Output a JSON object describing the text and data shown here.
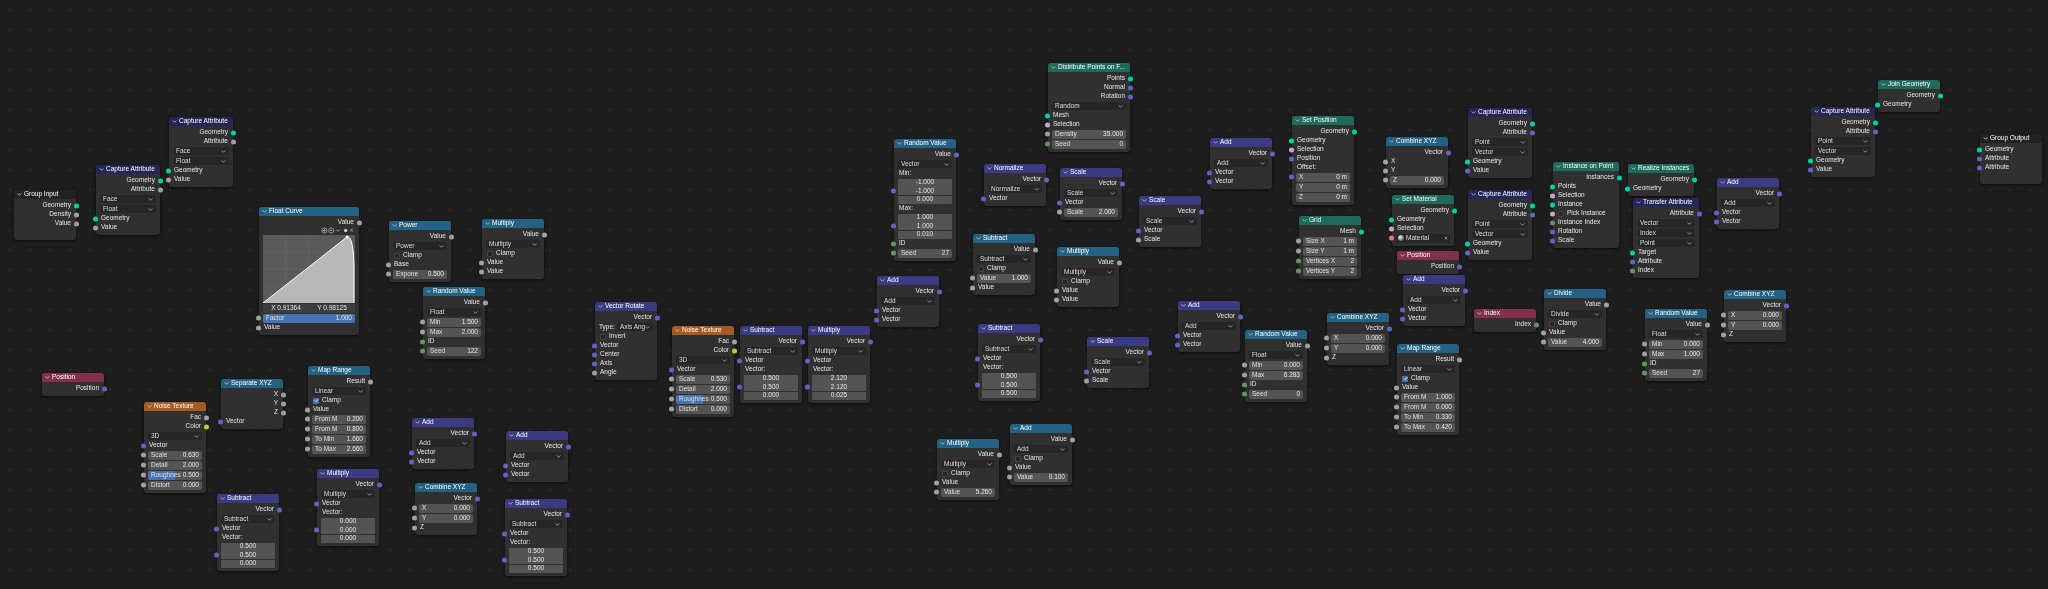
{
  "nodes": [
    {
      "title": "Group Input",
      "kind": "group",
      "rows": [
        {
          "kind": "out",
          "label": "Geometry",
          "color": "#00d6a3"
        },
        {
          "kind": "out",
          "label": "Density",
          "color": "#a1a1a1"
        },
        {
          "kind": "out",
          "label": "Value",
          "color": "#a1a1a1"
        },
        {
          "kind": "outstub"
        }
      ]
    },
    {
      "title": "Capture Attribute",
      "kind": "attribute",
      "rows": [
        {
          "kind": "out",
          "label": "Geometry",
          "color": "#00d6a3"
        },
        {
          "kind": "out",
          "label": "Attribute",
          "color": "#a1a1a1"
        },
        {
          "kind": "menu",
          "value": "Face"
        },
        {
          "kind": "menu",
          "value": "Float"
        },
        {
          "kind": "in",
          "label": "Geometry",
          "color": "#00d6a3"
        },
        {
          "kind": "in",
          "label": "Value",
          "color": "#a1a1a1"
        }
      ]
    },
    {
      "title": "Capture Attribute",
      "kind": "attribute",
      "rows": [
        {
          "kind": "out",
          "label": "Geometry",
          "color": "#00d6a3"
        },
        {
          "kind": "out",
          "label": "Attribute",
          "color": "#a1a1a1"
        },
        {
          "kind": "menu",
          "value": "Face"
        },
        {
          "kind": "menu",
          "value": "Float"
        },
        {
          "kind": "in",
          "label": "Geometry",
          "color": "#00d6a3"
        },
        {
          "kind": "in",
          "label": "Value",
          "color": "#a1a1a1"
        }
      ]
    },
    {
      "title": "Float Curve",
      "kind": "converter",
      "rows": [
        {
          "kind": "out",
          "label": "Value",
          "color": "#a1a1a1"
        },
        {
          "kind": "curve",
          "x_reading": "X 0.91364",
          "y_reading": "Y 0.98125"
        },
        {
          "kind": "slider",
          "label": "Factor",
          "value": "1.000",
          "level": 1,
          "color": "#a1a1a1"
        },
        {
          "kind": "in",
          "label": "Value",
          "color": "#a1a1a1"
        }
      ]
    },
    {
      "title": "Power",
      "kind": "converter",
      "rows": [
        {
          "kind": "out",
          "label": "Value",
          "color": "#a1a1a1"
        },
        {
          "kind": "menu",
          "value": "Power"
        },
        {
          "kind": "check",
          "label": "Clamp",
          "checked": false
        },
        {
          "kind": "in",
          "label": "Base",
          "color": "#a1a1a1"
        },
        {
          "kind": "field",
          "label": "Expone",
          "value": "0.500",
          "color": "#a1a1a1"
        }
      ]
    },
    {
      "title": "Random Value",
      "kind": "converter",
      "rows": [
        {
          "kind": "out",
          "label": "Value",
          "color": "#a1a1a1"
        },
        {
          "kind": "menu",
          "value": "Float"
        },
        {
          "kind": "field",
          "label": "Min",
          "value": "1.500",
          "color": "#a1a1a1"
        },
        {
          "kind": "field",
          "label": "Max",
          "value": "2.000",
          "color": "#a1a1a1"
        },
        {
          "kind": "in",
          "label": "ID",
          "color": "#5e9962"
        },
        {
          "kind": "field",
          "label": "Seed",
          "value": "122",
          "color": "#5e9962"
        }
      ]
    },
    {
      "title": "Multiply",
      "kind": "converter",
      "rows": [
        {
          "kind": "out",
          "label": "Value",
          "color": "#a1a1a1"
        },
        {
          "kind": "menu",
          "value": "Multiply"
        },
        {
          "kind": "check",
          "label": "Clamp",
          "checked": false
        },
        {
          "kind": "in",
          "label": "Value",
          "color": "#a1a1a1"
        },
        {
          "kind": "in",
          "label": "Value",
          "color": "#a1a1a1"
        }
      ]
    },
    {
      "title": "Position",
      "kind": "input",
      "rows": [
        {
          "kind": "out",
          "label": "Position",
          "color": "#6363c7"
        }
      ]
    },
    {
      "title": "Noise Texture",
      "kind": "texture",
      "rows": [
        {
          "kind": "out",
          "label": "Fac",
          "color": "#a1a1a1"
        },
        {
          "kind": "out",
          "label": "Color",
          "color": "#c7c729"
        },
        {
          "kind": "menu",
          "value": "3D"
        },
        {
          "kind": "in",
          "label": "Vector",
          "color": "#6363c7"
        },
        {
          "kind": "field",
          "label": "Scale",
          "value": "0.630",
          "color": "#a1a1a1"
        },
        {
          "kind": "field",
          "label": "Detail",
          "value": "2.000",
          "color": "#a1a1a1"
        },
        {
          "kind": "slider",
          "label": "Roughnes",
          "value": "0.500",
          "level": 0.5,
          "color": "#a1a1a1"
        },
        {
          "kind": "field",
          "label": "Distort",
          "value": "0.000",
          "color": "#a1a1a1"
        }
      ]
    },
    {
      "title": "Separate XYZ",
      "kind": "converter",
      "rows": [
        {
          "kind": "out",
          "label": "X",
          "color": "#a1a1a1"
        },
        {
          "kind": "out",
          "label": "Y",
          "color": "#a1a1a1"
        },
        {
          "kind": "out",
          "label": "Z",
          "color": "#a1a1a1"
        },
        {
          "kind": "in",
          "label": "Vector",
          "color": "#6363c7"
        }
      ]
    },
    {
      "title": "Map Range",
      "kind": "converter",
      "rows": [
        {
          "kind": "out",
          "label": "Result",
          "color": "#a1a1a1"
        },
        {
          "kind": "menu",
          "value": "Linear"
        },
        {
          "kind": "check",
          "label": "Clamp",
          "checked": true
        },
        {
          "kind": "in",
          "label": "Value",
          "color": "#a1a1a1"
        },
        {
          "kind": "field",
          "label": "From M",
          "value": "0.200",
          "color": "#a1a1a1"
        },
        {
          "kind": "field",
          "label": "From M",
          "value": "0.800",
          "color": "#a1a1a1"
        },
        {
          "kind": "field",
          "label": "To Min",
          "value": "1.660",
          "color": "#a1a1a1"
        },
        {
          "kind": "field",
          "label": "To Max",
          "value": "2.660",
          "color": "#a1a1a1"
        }
      ]
    },
    {
      "title": "Subtract",
      "kind": "vector",
      "rows": [
        {
          "kind": "out",
          "label": "Vector",
          "color": "#6363c7"
        },
        {
          "kind": "menu",
          "value": "Subtract"
        },
        {
          "kind": "in",
          "label": "Vector",
          "color": "#6363c7"
        },
        {
          "kind": "label",
          "text": "Vector:"
        },
        {
          "kind": "vector",
          "values": [
            "0.500",
            "0.500",
            "0.000"
          ],
          "color": "#6363c7"
        }
      ]
    },
    {
      "title": "Multiply",
      "kind": "vector",
      "rows": [
        {
          "kind": "out",
          "label": "Vector",
          "color": "#6363c7"
        },
        {
          "kind": "menu",
          "value": "Multiply"
        },
        {
          "kind": "in",
          "label": "Vector",
          "color": "#6363c7"
        },
        {
          "kind": "label",
          "text": "Vector:"
        },
        {
          "kind": "vector",
          "values": [
            "0.000",
            "0.000",
            "0.000"
          ],
          "color": "#6363c7"
        }
      ]
    },
    {
      "title": "Add",
      "kind": "vector",
      "rows": [
        {
          "kind": "out",
          "label": "Vector",
          "color": "#6363c7"
        },
        {
          "kind": "menu",
          "value": "Add"
        },
        {
          "kind": "in",
          "label": "Vector",
          "color": "#6363c7"
        },
        {
          "kind": "in",
          "label": "Vector",
          "color": "#6363c7"
        }
      ]
    },
    {
      "title": "Combine XYZ",
      "kind": "converter",
      "rows": [
        {
          "kind": "out",
          "label": "Vector",
          "color": "#6363c7"
        },
        {
          "kind": "field",
          "label": "X",
          "value": "0.000",
          "color": "#a1a1a1"
        },
        {
          "kind": "field",
          "label": "Y",
          "value": "0.000",
          "color": "#a1a1a1"
        },
        {
          "kind": "in",
          "label": "Z",
          "color": "#a1a1a1"
        }
      ]
    },
    {
      "title": "Add",
      "kind": "vector",
      "rows": [
        {
          "kind": "out",
          "label": "Vector",
          "color": "#6363c7"
        },
        {
          "kind": "menu",
          "value": "Add"
        },
        {
          "kind": "in",
          "label": "Vector",
          "color": "#6363c7"
        },
        {
          "kind": "in",
          "label": "Vector",
          "color": "#6363c7"
        }
      ]
    },
    {
      "title": "Subtract",
      "kind": "vector",
      "rows": [
        {
          "kind": "out",
          "label": "Vector",
          "color": "#6363c7"
        },
        {
          "kind": "menu",
          "value": "Subtract"
        },
        {
          "kind": "in",
          "label": "Vector",
          "color": "#6363c7"
        },
        {
          "kind": "label",
          "text": "Vector:"
        },
        {
          "kind": "vector",
          "values": [
            "0.500",
            "0.500",
            "0.500"
          ],
          "color": "#6363c7"
        }
      ]
    },
    {
      "title": "Vector Rotate",
      "kind": "vector",
      "rows": [
        {
          "kind": "out",
          "label": "Vector",
          "color": "#6363c7"
        },
        {
          "kind": "menu",
          "label": "Type:",
          "value": "Axis Ang"
        },
        {
          "kind": "check",
          "label": "Invert",
          "checked": false
        },
        {
          "kind": "in",
          "label": "Vector",
          "color": "#6363c7"
        },
        {
          "kind": "in",
          "label": "Center",
          "color": "#6363c7"
        },
        {
          "kind": "in",
          "label": "Axis",
          "color": "#6363c7"
        },
        {
          "kind": "in",
          "label": "Angle",
          "color": "#a1a1a1"
        }
      ]
    },
    {
      "title": "Noise Texture",
      "kind": "texture",
      "rows": [
        {
          "kind": "out",
          "label": "Fac",
          "color": "#a1a1a1"
        },
        {
          "kind": "out",
          "label": "Color",
          "color": "#c7c729"
        },
        {
          "kind": "menu",
          "value": "3D"
        },
        {
          "kind": "in",
          "label": "Vector",
          "color": "#6363c7"
        },
        {
          "kind": "field",
          "label": "Scale",
          "value": "0.530",
          "color": "#a1a1a1"
        },
        {
          "kind": "field",
          "label": "Detail",
          "value": "2.000",
          "color": "#a1a1a1"
        },
        {
          "kind": "slider",
          "label": "Roughnes",
          "value": "0.500",
          "level": 0.5,
          "color": "#a1a1a1"
        },
        {
          "kind": "field",
          "label": "Distort",
          "value": "0.000",
          "color": "#a1a1a1"
        }
      ]
    },
    {
      "title": "Subtract",
      "kind": "vector",
      "rows": [
        {
          "kind": "out",
          "label": "Vector",
          "color": "#6363c7"
        },
        {
          "kind": "menu",
          "value": "Subtract"
        },
        {
          "kind": "in",
          "label": "Vector",
          "color": "#6363c7"
        },
        {
          "kind": "label",
          "text": "Vector:"
        },
        {
          "kind": "vector",
          "values": [
            "0.500",
            "0.500",
            "0.000"
          ],
          "color": "#6363c7"
        }
      ]
    },
    {
      "title": "Multiply",
      "kind": "vector",
      "rows": [
        {
          "kind": "out",
          "label": "Vector",
          "color": "#6363c7"
        },
        {
          "kind": "menu",
          "value": "Multiply"
        },
        {
          "kind": "in",
          "label": "Vector",
          "color": "#6363c7"
        },
        {
          "kind": "label",
          "text": "Vector:"
        },
        {
          "kind": "vector",
          "values": [
            "2.120",
            "2.120",
            "0.025"
          ],
          "color": "#6363c7"
        }
      ]
    },
    {
      "title": "Add",
      "kind": "vector",
      "rows": [
        {
          "kind": "out",
          "label": "Vector",
          "color": "#6363c7"
        },
        {
          "kind": "menu",
          "value": "Add"
        },
        {
          "kind": "in",
          "label": "Vector",
          "color": "#6363c7"
        },
        {
          "kind": "in",
          "label": "Vector",
          "color": "#6363c7"
        }
      ]
    },
    {
      "title": "Random Value",
      "kind": "converter",
      "rows": [
        {
          "kind": "out",
          "label": "Value",
          "color": "#6363c7"
        },
        {
          "kind": "menu",
          "value": "Vector"
        },
        {
          "kind": "label",
          "text": "Min:"
        },
        {
          "kind": "vector",
          "values": [
            "-1.000",
            "-1.000",
            "0.000"
          ],
          "color": "#6363c7"
        },
        {
          "kind": "label",
          "text": "Max:"
        },
        {
          "kind": "vector",
          "values": [
            "1.000",
            "1.000",
            "0.010"
          ],
          "color": "#6363c7"
        },
        {
          "kind": "in",
          "label": "ID",
          "color": "#5e9962"
        },
        {
          "kind": "field",
          "label": "Seed",
          "value": "27",
          "color": "#5e9962"
        }
      ]
    },
    {
      "title": "Normalize",
      "kind": "vector",
      "rows": [
        {
          "kind": "out",
          "label": "Vector",
          "color": "#6363c7"
        },
        {
          "kind": "menu",
          "value": "Normalize"
        },
        {
          "kind": "in",
          "label": "Vector",
          "color": "#6363c7"
        }
      ]
    },
    {
      "title": "Subtract",
      "kind": "converter",
      "rows": [
        {
          "kind": "out",
          "label": "Value",
          "color": "#a1a1a1"
        },
        {
          "kind": "menu",
          "value": "Subtract"
        },
        {
          "kind": "check",
          "label": "Clamp",
          "checked": false
        },
        {
          "kind": "field",
          "label": "Value",
          "value": "1.000",
          "color": "#a1a1a1"
        },
        {
          "kind": "in",
          "label": "Value",
          "color": "#a1a1a1"
        }
      ]
    },
    {
      "title": "Subtract",
      "kind": "vector",
      "rows": [
        {
          "kind": "out",
          "label": "Vector",
          "color": "#6363c7"
        },
        {
          "kind": "menu",
          "value": "Subtract"
        },
        {
          "kind": "in",
          "label": "Vector",
          "color": "#6363c7"
        },
        {
          "kind": "label",
          "text": "Vector:"
        },
        {
          "kind": "vector",
          "values": [
            "0.500",
            "0.500",
            "0.500"
          ],
          "color": "#6363c7"
        }
      ]
    },
    {
      "title": "Multiply",
      "kind": "converter",
      "rows": [
        {
          "kind": "out",
          "label": "Value",
          "color": "#a1a1a1"
        },
        {
          "kind": "menu",
          "value": "Multiply"
        },
        {
          "kind": "check",
          "label": "Clamp",
          "checked": false
        },
        {
          "kind": "in",
          "label": "Value",
          "color": "#a1a1a1"
        },
        {
          "kind": "field",
          "label": "Value",
          "value": "5.260",
          "color": "#a1a1a1"
        }
      ]
    },
    {
      "title": "Add",
      "kind": "converter",
      "rows": [
        {
          "kind": "out",
          "label": "Value",
          "color": "#a1a1a1"
        },
        {
          "kind": "menu",
          "value": "Add"
        },
        {
          "kind": "check",
          "label": "Clamp",
          "checked": false
        },
        {
          "kind": "in",
          "label": "Value",
          "color": "#a1a1a1"
        },
        {
          "kind": "field",
          "label": "Value",
          "value": "0.100",
          "color": "#a1a1a1"
        }
      ]
    },
    {
      "title": "Distribute Points on F...",
      "kind": "geometry",
      "rows": [
        {
          "kind": "out",
          "label": "Points",
          "color": "#00d6a3"
        },
        {
          "kind": "out",
          "label": "Normal",
          "color": "#6363c7"
        },
        {
          "kind": "out",
          "label": "Rotation",
          "color": "#6363c7"
        },
        {
          "kind": "menu",
          "value": "Random"
        },
        {
          "kind": "in",
          "label": "Mesh",
          "color": "#00d6a3"
        },
        {
          "kind": "in",
          "label": "Selection",
          "color": "#cca6d6"
        },
        {
          "kind": "field",
          "label": "Density",
          "value": "35.000",
          "color": "#a1a1a1"
        },
        {
          "kind": "field",
          "label": "Seed",
          "value": "0",
          "color": "#5e9962"
        }
      ]
    },
    {
      "title": "Scale",
      "kind": "vector",
      "rows": [
        {
          "kind": "out",
          "label": "Vector",
          "color": "#6363c7"
        },
        {
          "kind": "menu",
          "value": "Scale"
        },
        {
          "kind": "in",
          "label": "Vector",
          "color": "#6363c7"
        },
        {
          "kind": "field",
          "label": "Scale",
          "value": "2.000",
          "color": "#a1a1a1"
        }
      ]
    },
    {
      "title": "Scale",
      "kind": "vector",
      "rows": [
        {
          "kind": "out",
          "label": "Vector",
          "color": "#6363c7"
        },
        {
          "kind": "menu",
          "value": "Scale"
        },
        {
          "kind": "in",
          "label": "Vector",
          "color": "#6363c7"
        },
        {
          "kind": "in",
          "label": "Scale",
          "color": "#a1a1a1"
        }
      ]
    },
    {
      "title": "Add",
      "kind": "vector",
      "rows": [
        {
          "kind": "out",
          "label": "Vector",
          "color": "#6363c7"
        },
        {
          "kind": "menu",
          "value": "Add"
        },
        {
          "kind": "in",
          "label": "Vector",
          "color": "#6363c7"
        },
        {
          "kind": "in",
          "label": "Vector",
          "color": "#6363c7"
        }
      ]
    },
    {
      "title": "Multiply",
      "kind": "converter",
      "rows": [
        {
          "kind": "out",
          "label": "Value",
          "color": "#a1a1a1"
        },
        {
          "kind": "menu",
          "value": "Multiply"
        },
        {
          "kind": "check",
          "label": "Clamp",
          "checked": false
        },
        {
          "kind": "in",
          "label": "Value",
          "color": "#a1a1a1"
        },
        {
          "kind": "in",
          "label": "Value",
          "color": "#a1a1a1"
        }
      ]
    },
    {
      "title": "Set Position",
      "kind": "geometry",
      "rows": [
        {
          "kind": "out",
          "label": "Geometry",
          "color": "#00d6a3"
        },
        {
          "kind": "in",
          "label": "Geometry",
          "color": "#00d6a3"
        },
        {
          "kind": "in",
          "label": "Selection",
          "color": "#cca6d6"
        },
        {
          "kind": "in",
          "label": "Position",
          "color": "#6363c7"
        },
        {
          "kind": "label",
          "text": "Offset:"
        },
        {
          "kind": "field",
          "label": "X",
          "value": "0 m",
          "color": "#6363c7"
        },
        {
          "kind": "field",
          "label": "Y",
          "value": "0 m"
        },
        {
          "kind": "field",
          "label": "Z",
          "value": "0 m"
        }
      ]
    },
    {
      "title": "Combine XYZ",
      "kind": "converter",
      "rows": [
        {
          "kind": "out",
          "label": "Vector",
          "color": "#6363c7"
        },
        {
          "kind": "in",
          "label": "X",
          "color": "#a1a1a1"
        },
        {
          "kind": "in",
          "label": "Y",
          "color": "#a1a1a1"
        },
        {
          "kind": "field",
          "label": "Z",
          "value": "0.000",
          "color": "#a1a1a1"
        }
      ]
    },
    {
      "title": "Capture Attribute",
      "kind": "attribute",
      "rows": [
        {
          "kind": "out",
          "label": "Geometry",
          "color": "#00d6a3"
        },
        {
          "kind": "out",
          "label": "Attribute",
          "color": "#6363c7"
        },
        {
          "kind": "menu",
          "value": "Point"
        },
        {
          "kind": "menu",
          "value": "Vector"
        },
        {
          "kind": "in",
          "label": "Geometry",
          "color": "#00d6a3"
        },
        {
          "kind": "in",
          "label": "Value",
          "color": "#6363c7"
        }
      ]
    },
    {
      "title": "Set Material",
      "kind": "geometry",
      "rows": [
        {
          "kind": "out",
          "label": "Geometry",
          "color": "#00d6a3"
        },
        {
          "kind": "in",
          "label": "Geometry",
          "color": "#00d6a3"
        },
        {
          "kind": "in",
          "label": "Selection",
          "color": "#cca6d6"
        },
        {
          "kind": "material",
          "value": "Material",
          "color": "#eb7582"
        }
      ]
    },
    {
      "title": "Grid",
      "kind": "geometry",
      "rows": [
        {
          "kind": "out",
          "label": "Mesh",
          "color": "#00d6a3"
        },
        {
          "kind": "field",
          "label": "Size X",
          "value": "1 m",
          "color": "#a1a1a1"
        },
        {
          "kind": "field",
          "label": "Size Y",
          "value": "1 m",
          "color": "#a1a1a1"
        },
        {
          "kind": "field",
          "label": "Vertices X",
          "value": "2",
          "color": "#5e9962"
        },
        {
          "kind": "field",
          "label": "Vertices Y",
          "value": "2",
          "color": "#5e9962"
        }
      ]
    },
    {
      "title": "Capture Attribute",
      "kind": "attribute",
      "rows": [
        {
          "kind": "out",
          "label": "Geometry",
          "color": "#00d6a3"
        },
        {
          "kind": "out",
          "label": "Attribute",
          "color": "#6363c7"
        },
        {
          "kind": "menu",
          "value": "Point"
        },
        {
          "kind": "menu",
          "value": "Vector"
        },
        {
          "kind": "in",
          "label": "Geometry",
          "color": "#00d6a3"
        },
        {
          "kind": "in",
          "label": "Value",
          "color": "#6363c7"
        }
      ]
    },
    {
      "title": "Position",
      "kind": "input",
      "rows": [
        {
          "kind": "out",
          "label": "Position",
          "color": "#6363c7"
        }
      ]
    },
    {
      "title": "Add",
      "kind": "vector",
      "rows": [
        {
          "kind": "out",
          "label": "Vector",
          "color": "#6363c7"
        },
        {
          "kind": "menu",
          "value": "Add"
        },
        {
          "kind": "in",
          "label": "Vector",
          "color": "#6363c7"
        },
        {
          "kind": "in",
          "label": "Vector",
          "color": "#6363c7"
        }
      ]
    },
    {
      "title": "Add",
      "kind": "vector",
      "rows": [
        {
          "kind": "out",
          "label": "Vector",
          "color": "#6363c7"
        },
        {
          "kind": "menu",
          "value": "Add"
        },
        {
          "kind": "in",
          "label": "Vector",
          "color": "#6363c7"
        },
        {
          "kind": "in",
          "label": "Vector",
          "color": "#6363c7"
        }
      ]
    },
    {
      "title": "Combine XYZ",
      "kind": "converter",
      "rows": [
        {
          "kind": "out",
          "label": "Vector",
          "color": "#6363c7"
        },
        {
          "kind": "field",
          "label": "X",
          "value": "0.000",
          "color": "#a1a1a1"
        },
        {
          "kind": "field",
          "label": "Y",
          "value": "0.000",
          "color": "#a1a1a1"
        },
        {
          "kind": "in",
          "label": "Z",
          "color": "#a1a1a1"
        }
      ]
    },
    {
      "title": "Random Value",
      "kind": "converter",
      "rows": [
        {
          "kind": "out",
          "label": "Value",
          "color": "#a1a1a1"
        },
        {
          "kind": "menu",
          "value": "Float"
        },
        {
          "kind": "field",
          "label": "Min",
          "value": "0.000",
          "color": "#a1a1a1"
        },
        {
          "kind": "field",
          "label": "Max",
          "value": "6.283",
          "color": "#a1a1a1"
        },
        {
          "kind": "in",
          "label": "ID",
          "color": "#5e9962"
        },
        {
          "kind": "field",
          "label": "Seed",
          "value": "0",
          "color": "#5e9962"
        }
      ]
    },
    {
      "title": "Scale",
      "kind": "vector",
      "rows": [
        {
          "kind": "out",
          "label": "Vector",
          "color": "#6363c7"
        },
        {
          "kind": "menu",
          "value": "Scale"
        },
        {
          "kind": "in",
          "label": "Vector",
          "color": "#6363c7"
        },
        {
          "kind": "in",
          "label": "Scale",
          "color": "#a1a1a1"
        }
      ]
    },
    {
      "title": "Index",
      "kind": "input",
      "rows": [
        {
          "kind": "out",
          "label": "Index",
          "color": "#5e9962"
        }
      ]
    },
    {
      "title": "Map Range",
      "kind": "converter",
      "rows": [
        {
          "kind": "out",
          "label": "Result",
          "color": "#a1a1a1"
        },
        {
          "kind": "menu",
          "value": "Linear"
        },
        {
          "kind": "check",
          "label": "Clamp",
          "checked": true
        },
        {
          "kind": "in",
          "label": "Value",
          "color": "#a1a1a1"
        },
        {
          "kind": "field",
          "label": "From M",
          "value": "1.000",
          "color": "#a1a1a1"
        },
        {
          "kind": "field",
          "label": "From M",
          "value": "0.000",
          "color": "#a1a1a1"
        },
        {
          "kind": "field",
          "label": "To Min",
          "value": "0.330",
          "color": "#a1a1a1"
        },
        {
          "kind": "field",
          "label": "To Max",
          "value": "0.420",
          "color": "#a1a1a1"
        }
      ]
    },
    {
      "title": "Instance on Point",
      "kind": "geometry",
      "rows": [
        {
          "kind": "out",
          "label": "Instances",
          "color": "#00d6a3"
        },
        {
          "kind": "in",
          "label": "Points",
          "color": "#00d6a3"
        },
        {
          "kind": "in",
          "label": "Selection",
          "color": "#cca6d6"
        },
        {
          "kind": "in",
          "label": "Instance",
          "color": "#00d6a3"
        },
        {
          "kind": "check",
          "label": "Pick Instance",
          "checked": false,
          "color": "#cca6d6"
        },
        {
          "kind": "in",
          "label": "Instance Index",
          "color": "#5e9962"
        },
        {
          "kind": "in",
          "label": "Rotation",
          "color": "#6363c7"
        },
        {
          "kind": "in",
          "label": "Scale",
          "color": "#6363c7"
        }
      ]
    },
    {
      "title": "Realize Instances",
      "kind": "geometry",
      "rows": [
        {
          "kind": "out",
          "label": "Geometry",
          "color": "#00d6a3"
        },
        {
          "kind": "in",
          "label": "Geometry",
          "color": "#00d6a3"
        }
      ]
    },
    {
      "title": "Transfer Attribute",
      "kind": "attribute",
      "rows": [
        {
          "kind": "out",
          "label": "Attribute",
          "color": "#6363c7"
        },
        {
          "kind": "menu",
          "value": "Vector"
        },
        {
          "kind": "menu",
          "value": "Index"
        },
        {
          "kind": "menu",
          "value": "Point"
        },
        {
          "kind": "in",
          "label": "Target",
          "color": "#00d6a3"
        },
        {
          "kind": "in",
          "label": "Attribute",
          "color": "#6363c7"
        },
        {
          "kind": "in",
          "label": "Index",
          "color": "#5e9962"
        }
      ]
    },
    {
      "title": "Add",
      "kind": "vector",
      "rows": [
        {
          "kind": "out",
          "label": "Vector",
          "color": "#6363c7"
        },
        {
          "kind": "menu",
          "value": "Add"
        },
        {
          "kind": "in",
          "label": "Vector",
          "color": "#6363c7"
        },
        {
          "kind": "in",
          "label": "Vector",
          "color": "#6363c7"
        }
      ]
    },
    {
      "title": "Capture Attribute",
      "kind": "attribute",
      "rows": [
        {
          "kind": "out",
          "label": "Geometry",
          "color": "#00d6a3"
        },
        {
          "kind": "out",
          "label": "Attribute",
          "color": "#6363c7"
        },
        {
          "kind": "menu",
          "value": "Point"
        },
        {
          "kind": "menu",
          "value": "Vector"
        },
        {
          "kind": "in",
          "label": "Geometry",
          "color": "#00d6a3"
        },
        {
          "kind": "in",
          "label": "Value",
          "color": "#6363c7"
        }
      ]
    },
    {
      "title": "Join Geometry",
      "kind": "geometry",
      "rows": [
        {
          "kind": "out",
          "label": "Geometry",
          "color": "#00d6a3"
        },
        {
          "kind": "in",
          "label": "Geometry",
          "color": "#00d6a3"
        }
      ]
    },
    {
      "title": "Group Output",
      "kind": "group",
      "rows": [
        {
          "kind": "in",
          "label": "Geometry",
          "color": "#00d6a3"
        },
        {
          "kind": "in",
          "label": "Attribute",
          "color": "#6363c7"
        },
        {
          "kind": "in",
          "label": "Attribute",
          "color": "#6363c7"
        },
        {
          "kind": "instub"
        }
      ]
    },
    {
      "title": "Divide",
      "kind": "converter",
      "rows": [
        {
          "kind": "out",
          "label": "Value",
          "color": "#a1a1a1"
        },
        {
          "kind": "menu",
          "value": "Divide"
        },
        {
          "kind": "check",
          "label": "Clamp",
          "checked": false
        },
        {
          "kind": "in",
          "label": "Value",
          "color": "#a1a1a1"
        },
        {
          "kind": "field",
          "label": "Value",
          "value": "4.000",
          "color": "#a1a1a1"
        }
      ]
    },
    {
      "title": "Random Value",
      "kind": "converter",
      "rows": [
        {
          "kind": "out",
          "label": "Value",
          "color": "#a1a1a1"
        },
        {
          "kind": "menu",
          "value": "Float"
        },
        {
          "kind": "field",
          "label": "Min",
          "value": "0.000",
          "color": "#a1a1a1"
        },
        {
          "kind": "field",
          "label": "Max",
          "value": "1.000",
          "color": "#a1a1a1"
        },
        {
          "kind": "in",
          "label": "ID",
          "color": "#5e9962"
        },
        {
          "kind": "field",
          "label": "Seed",
          "value": "27",
          "color": "#5e9962"
        }
      ]
    },
    {
      "title": "Combine XYZ",
      "kind": "converter",
      "rows": [
        {
          "kind": "out",
          "label": "Vector",
          "color": "#6363c7"
        },
        {
          "kind": "field",
          "label": "X",
          "value": "0.000",
          "color": "#a1a1a1"
        },
        {
          "kind": "field",
          "label": "Y",
          "value": "0.000",
          "color": "#a1a1a1"
        },
        {
          "kind": "in",
          "label": "Z",
          "color": "#a1a1a1"
        }
      ]
    }
  ]
}
